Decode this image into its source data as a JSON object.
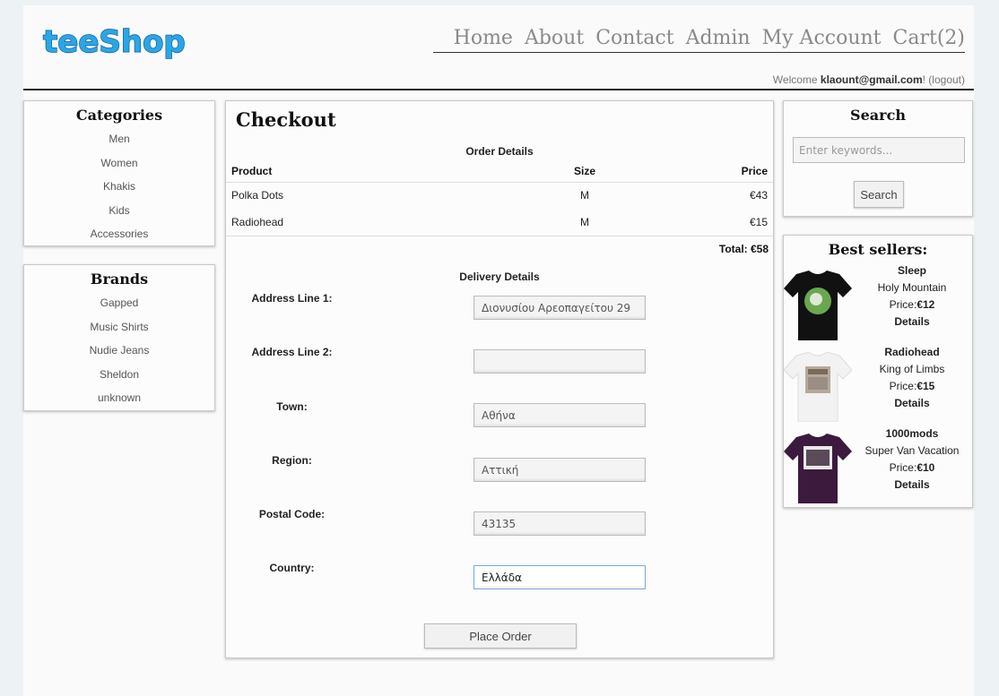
{
  "header": {
    "logo_text": "teeShop",
    "nav": [
      "Home",
      "About",
      "Contact",
      "Admin",
      "My Account",
      "Cart(2)"
    ],
    "welcome_prefix": "Welcome ",
    "welcome_user": "klaount@gmail.com",
    "welcome_suffix": "! (logout)"
  },
  "categories": {
    "title": "Categories",
    "items": [
      "Men",
      "Women",
      "Khakis",
      "Kids",
      "Accessories"
    ]
  },
  "brands": {
    "title": "Brands",
    "items": [
      "Gapped",
      "Music Shirts",
      "Nudie Jeans",
      "Sheldon",
      "unknown"
    ]
  },
  "checkout": {
    "title": "Checkout",
    "order_details_title": "Order Details",
    "columns": [
      "Product",
      "Size",
      "Price"
    ],
    "rows": [
      {
        "product": "Polka Dots",
        "size": "M",
        "price": "€43"
      },
      {
        "product": "Radiohead",
        "size": "M",
        "price": "€15"
      }
    ],
    "total": "Total: €58",
    "delivery_title": "Delivery Details",
    "fields": [
      {
        "label": "Address Line 1:",
        "value": "Διονυσίου Αρεοπαγείτου 29"
      },
      {
        "label": "Address Line 2:",
        "value": ""
      },
      {
        "label": "Town:",
        "value": "Αθήνα"
      },
      {
        "label": "Region:",
        "value": "Αττική"
      },
      {
        "label": "Postal Code:",
        "value": "43135"
      },
      {
        "label": "Country:",
        "value": "Ελλάδα"
      }
    ],
    "place_order": "Place Order"
  },
  "search": {
    "title": "Search",
    "placeholder": "Enter keywords...",
    "button": "Search"
  },
  "best_sellers": {
    "title": "Best sellers:",
    "items": [
      {
        "band": "Sleep",
        "name": "Holy Mountain",
        "price_label": "Price:",
        "price": "€12",
        "details": "Details",
        "shirt_color": "#111111"
      },
      {
        "band": "Radiohead",
        "name": "King of Limbs",
        "price_label": "Price:",
        "price": "€15",
        "details": "Details",
        "shirt_color": "#f2f2f2"
      },
      {
        "band": "1000mods",
        "name": "Super Van Vacation",
        "price_label": "Price:",
        "price": "€10",
        "details": "Details",
        "shirt_color": "#3b1a3d"
      }
    ]
  },
  "colors": {
    "logo": "#2aa6e8",
    "page_bg": "#edf2f5",
    "nav_text": "#8a8a8a"
  }
}
